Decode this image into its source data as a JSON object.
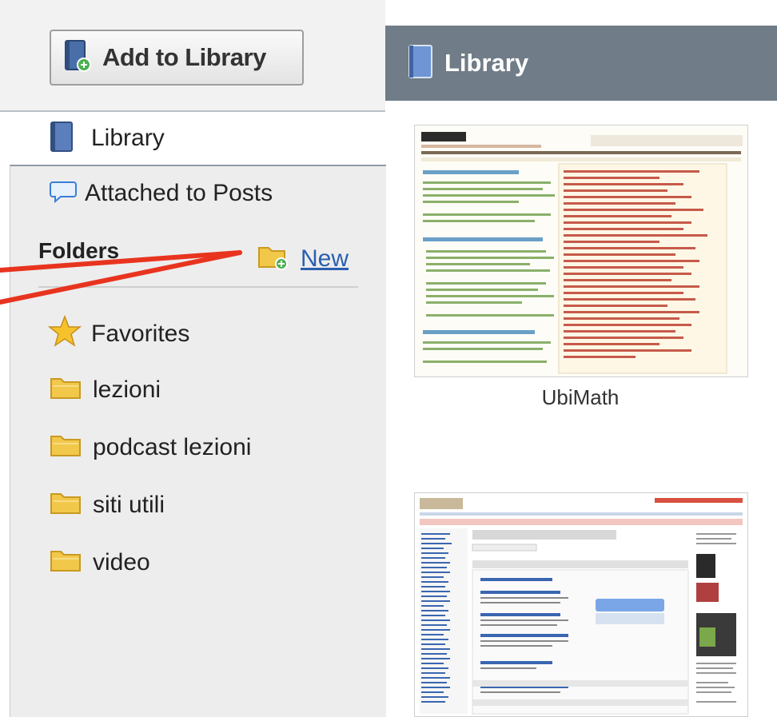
{
  "sidebar": {
    "add_button_label": "Add to Library",
    "library_label": "Library",
    "attached_label": "Attached to Posts",
    "folders_heading": "Folders",
    "new_label": "New",
    "folders": [
      "Favorites",
      "lezioni",
      "podcast lezioni",
      "siti utili",
      "video"
    ]
  },
  "main": {
    "title": "Library",
    "items": [
      {
        "caption": "UbiMath"
      },
      {
        "caption": ""
      }
    ]
  },
  "colors": {
    "header_bg": "#707c87",
    "link": "#2a5fb0",
    "annotation_arrow": "#e8341f",
    "folder_icon": "#f2c84b"
  }
}
